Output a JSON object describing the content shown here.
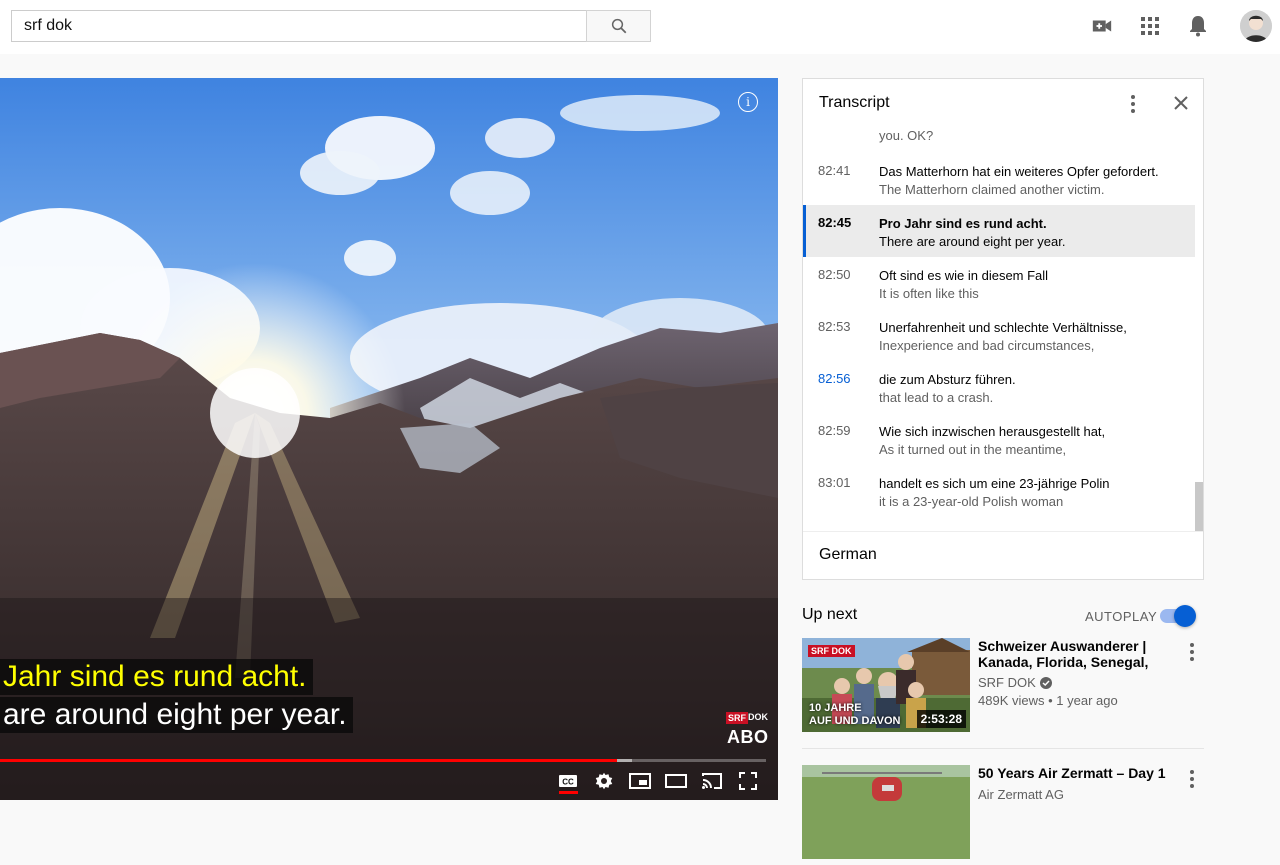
{
  "search": {
    "value": "srf dok"
  },
  "header_icons": [
    "create-video-icon",
    "apps-grid-icon",
    "notifications-bell-icon",
    "avatar"
  ],
  "player": {
    "captions": [
      "Jahr sind es rund acht.",
      "are around eight per year."
    ],
    "watermark": {
      "srf": "SRF",
      "dok": "DOK",
      "abo": "ABO"
    },
    "progress_fraction": 0.806,
    "buffer_fraction": 0.826,
    "controls": [
      "cc-icon",
      "settings-gear-icon",
      "miniplayer-icon",
      "theater-mode-icon",
      "cast-icon",
      "fullscreen-icon"
    ]
  },
  "transcript": {
    "title": "Transcript",
    "language": "German",
    "partial_top": "you. OK?",
    "rows": [
      {
        "time": "82:41",
        "de": "Das Matterhorn hat ein weiteres Opfer gefordert.",
        "en": "The Matterhorn claimed another victim.",
        "state": "normal"
      },
      {
        "time": "82:45",
        "de": "Pro Jahr sind es rund acht.",
        "en": "There are around eight per year.",
        "state": "active"
      },
      {
        "time": "82:50",
        "de": "Oft sind es wie in diesem Fall",
        "en": "It is often like this",
        "state": "normal"
      },
      {
        "time": "82:53",
        "de": "Unerfahrenheit und schlechte Verhältnisse,",
        "en": "Inexperience and bad circumstances,",
        "state": "normal"
      },
      {
        "time": "82:56",
        "de": "die zum Absturz führen.",
        "en": "that lead to a crash.",
        "state": "hover"
      },
      {
        "time": "82:59",
        "de": "Wie sich inzwischen herausgestellt hat,",
        "en": "As it turned out in the meantime,",
        "state": "normal"
      },
      {
        "time": "83:01",
        "de": "handelt es sich um eine 23-jährige Polin",
        "en": "it is a 23-year-old Polish woman",
        "state": "normal"
      }
    ]
  },
  "up_next": {
    "label": "Up next",
    "autoplay_label": "AUTOPLAY",
    "autoplay_on": true,
    "videos": [
      {
        "title": "Schweizer Auswanderer | Kanada, Florida, Senegal, Beliz…",
        "channel": "SRF DOK",
        "verified": true,
        "views": "489K views",
        "age": "1 year ago",
        "duration": "2:53:28",
        "thumb_badge": "SRF DOK",
        "thumb_text_1": "10 JAHRE",
        "thumb_text_2": "AUF UND DAVON"
      },
      {
        "title": "50 Years Air Zermatt – Day 1",
        "channel": "Air Zermatt AG"
      }
    ]
  }
}
